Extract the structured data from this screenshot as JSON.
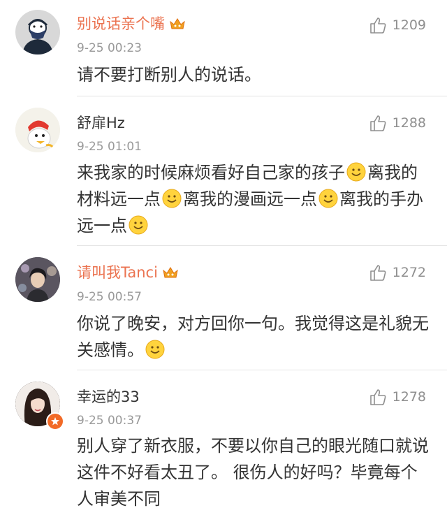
{
  "comments": [
    {
      "username": "别说话亲个嘴",
      "vip": true,
      "time": "9-25 00:23",
      "likes": "1209",
      "text": [
        "请不要打断别人的说话。"
      ],
      "avatar": "masked-person-avatar"
    },
    {
      "username": "舒扉Hz",
      "vip": false,
      "time": "9-25 01:01",
      "likes": "1288",
      "text": [
        "来我家的时候麻烦看好自己家的孩子",
        "离我的材料远一点",
        "离我的漫画远一点",
        "离我的手办远一点"
      ],
      "avatar": "cartoon-avatar"
    },
    {
      "username": "请叫我Tanci",
      "vip": true,
      "time": "9-25 00:57",
      "likes": "1272",
      "text": [
        "你说了晚安，对方回你一句。我觉得这是礼貌无关感情。"
      ],
      "avatar": "person-photo-avatar"
    },
    {
      "username": "幸运的33",
      "vip": false,
      "time": "9-25 00:37",
      "likes": "1278",
      "text": [
        "别人穿了新衣服，不要以你自己的眼光随口就说这件不好看太丑了。 很伤人的好吗？毕竟每个人审美不同"
      ],
      "avatar": "woman-photo-avatar"
    }
  ],
  "colors": {
    "vip_name": "#eb7350",
    "time": "#999999",
    "like": "#8f8f8f",
    "verified_badge": "#f26a27"
  },
  "icons": {
    "like": "thumbs-up-icon",
    "vip": "crown-icon",
    "emoji": "smile-emoji-icon",
    "verified": "star-badge-icon"
  }
}
